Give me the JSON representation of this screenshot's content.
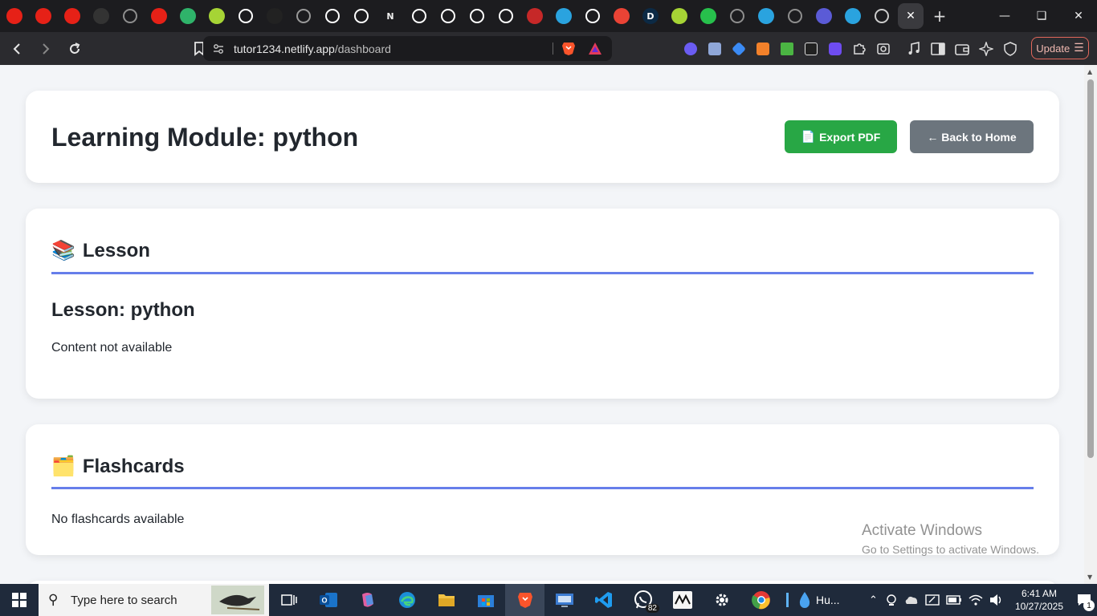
{
  "browser": {
    "tabs": [
      {
        "icon": "youtube-icon",
        "color": "#e62117"
      },
      {
        "icon": "youtube-icon",
        "color": "#e62117"
      },
      {
        "icon": "youtube-icon",
        "color": "#e62117"
      },
      {
        "icon": "github-icon",
        "color": "#333333"
      },
      {
        "icon": "chatgpt-icon",
        "color": "#8e8e8e"
      },
      {
        "icon": "youtube-icon",
        "color": "#e62117"
      },
      {
        "icon": "play-icon",
        "color": "#2fb36a"
      },
      {
        "icon": "circle-app-icon",
        "color": "#a6d435"
      },
      {
        "icon": "google-icon",
        "color": "#ffffff"
      },
      {
        "icon": "triangle-app-icon",
        "color": "#222222"
      },
      {
        "icon": "spy-icon",
        "color": "#9a9a9a"
      },
      {
        "icon": "github-icon",
        "color": "#ffffff"
      },
      {
        "icon": "github-icon",
        "color": "#ffffff"
      },
      {
        "icon": "notion-icon",
        "color": "#ffffff",
        "label": "N"
      },
      {
        "icon": "chatgpt-icon",
        "color": "#ffffff"
      },
      {
        "icon": "github-icon",
        "color": "#ffffff"
      },
      {
        "icon": "chatgpt-icon",
        "color": "#ffffff"
      },
      {
        "icon": "speaker-icon",
        "color": "#ffffff"
      },
      {
        "icon": "news-icon",
        "color": "#c62828"
      },
      {
        "icon": "telegram-icon",
        "color": "#2aa3df"
      },
      {
        "icon": "github-icon",
        "color": "#ffffff"
      },
      {
        "icon": "gmail-icon",
        "color": "#ea4335"
      },
      {
        "icon": "d-app-icon",
        "color": "#0c2a45",
        "label": "D"
      },
      {
        "icon": "circle-app-icon",
        "color": "#a6d435"
      },
      {
        "icon": "circle-app-icon",
        "color": "#27c04c"
      },
      {
        "icon": "chatgpt-icon",
        "color": "#8e8e8e"
      },
      {
        "icon": "telegram-icon",
        "color": "#2aa3df"
      },
      {
        "icon": "chatgpt-icon",
        "color": "#8e8e8e"
      },
      {
        "icon": "list-app-icon",
        "color": "#5b5bd6"
      },
      {
        "icon": "telegram-icon",
        "color": "#2aa3df"
      },
      {
        "icon": "chatgpt-icon",
        "color": "#cccccc"
      }
    ],
    "active_tab_close": "✕",
    "new_tab": "+",
    "url_host": "tutor1234.netlify.app",
    "url_path": "/dashboard",
    "update_label": "Update"
  },
  "page": {
    "title": "Learning Module: python",
    "export_label": "Export PDF",
    "export_icon": "📄",
    "back_label": "← Back to Home",
    "lesson_heading": "Lesson",
    "lesson_icon": "📚",
    "lesson_title": "Lesson: python",
    "lesson_content": "Content not available",
    "flashcards_heading": "Flashcards",
    "flashcards_icon": "🗂️",
    "flashcards_content": "No flashcards available",
    "accent_color": "#667eea",
    "export_color": "#28a745",
    "back_color": "#6c757d"
  },
  "watermark": {
    "line1": "Activate Windows",
    "line2": "Go to Settings to activate Windows."
  },
  "taskbar": {
    "search_placeholder": "Type here to search",
    "whatsapp_badge": "82",
    "app_label": "Hu...",
    "time": "6:41 AM",
    "date": "10/27/2025",
    "notification_count": "1"
  }
}
